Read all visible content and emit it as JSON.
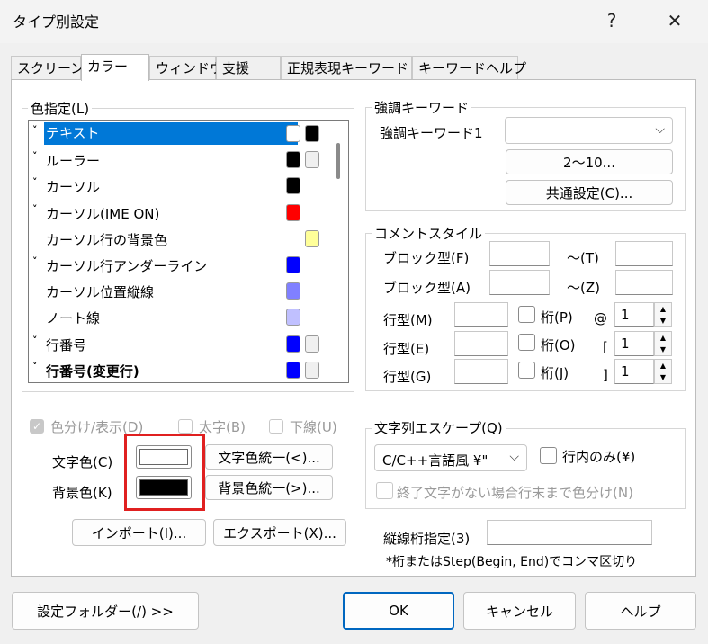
{
  "window": {
    "title": "タイプ別設定",
    "help": "?",
    "close": "✕"
  },
  "tabs": [
    "スクリーン",
    "カラー",
    "ウィンドウ",
    "支援",
    "正規表現キーワード",
    "キーワードヘルプ"
  ],
  "color_group": {
    "legend": "色指定(L)",
    "items": [
      {
        "label": "テキスト",
        "chev": "˅",
        "c1": "#ffffff",
        "c2": "#000000"
      },
      {
        "label": "ルーラー",
        "chev": "˅",
        "c1": "#000000",
        "c2": "#f0f0f0"
      },
      {
        "label": "カーソル",
        "chev": "˅",
        "c1": "#000000"
      },
      {
        "label": "カーソル(IME ON)",
        "chev": "˅",
        "c1": "#ff0000"
      },
      {
        "label": "カーソル行の背景色",
        "chev": "",
        "c2": "#ffff99"
      },
      {
        "label": "カーソル行アンダーライン",
        "chev": "˅",
        "c1": "#0000ff"
      },
      {
        "label": "カーソル位置縦線",
        "chev": "",
        "c1": "#8080ff"
      },
      {
        "label": "ノート線",
        "chev": "",
        "c1": "#c0c0ff"
      },
      {
        "label": "行番号",
        "chev": "˅",
        "c1": "#0000ff",
        "c2": "#f0f0f0"
      },
      {
        "label": "行番号(変更行)",
        "chev": "˅",
        "c1": "#0000ff",
        "c2": "#f0f0f0"
      }
    ],
    "chk_color_display": "色分け/表示(D)",
    "chk_bold": "太字(B)",
    "chk_underline": "下線(U)",
    "text_color_label": "文字色(C)",
    "bg_color_label": "背景色(K)",
    "text_color_value": "#ffffff",
    "bg_color_value": "#000000",
    "unify_text": "文字色統一(<)...",
    "unify_bg": "背景色統一(>)...",
    "import": "インポート(I)...",
    "export": "エクスポート(X)..."
  },
  "keyword_group": {
    "legend": "強調キーワード",
    "label": "強調キーワード1",
    "combo_value": "",
    "btn_2_10": "2〜10...",
    "btn_common": "共通設定(C)..."
  },
  "comment_group": {
    "legend": "コメントスタイル",
    "block1": "ブロック型(F)",
    "block1_to": "〜(T)",
    "block2": "ブロック型(A)",
    "block2_to": "〜(Z)",
    "line1": "行型(M)",
    "line2": "行型(E)",
    "line3": "行型(G)",
    "col1": "桁(P)",
    "col2": "桁(O)",
    "col3": "桁(J)",
    "sym1": "@",
    "sym2": "[",
    "sym3": "]",
    "spin1": "1",
    "spin2": "1",
    "spin3": "1"
  },
  "escape_group": {
    "legend": "文字列エスケープ(Q)",
    "combo_value": "C/C++言語風 ¥\"",
    "chk_inline": "行内のみ(¥)",
    "chk_eol": "終了文字がない場合行末まで色分け(N)"
  },
  "vline": {
    "label": "縦線桁指定(3)",
    "value": "",
    "note": "*桁またはStep(Begin, End)でコンマ区切り"
  },
  "footer": {
    "folder": "設定フォルダー(/) >>",
    "ok": "OK",
    "cancel": "キャンセル",
    "help": "ヘルプ"
  }
}
